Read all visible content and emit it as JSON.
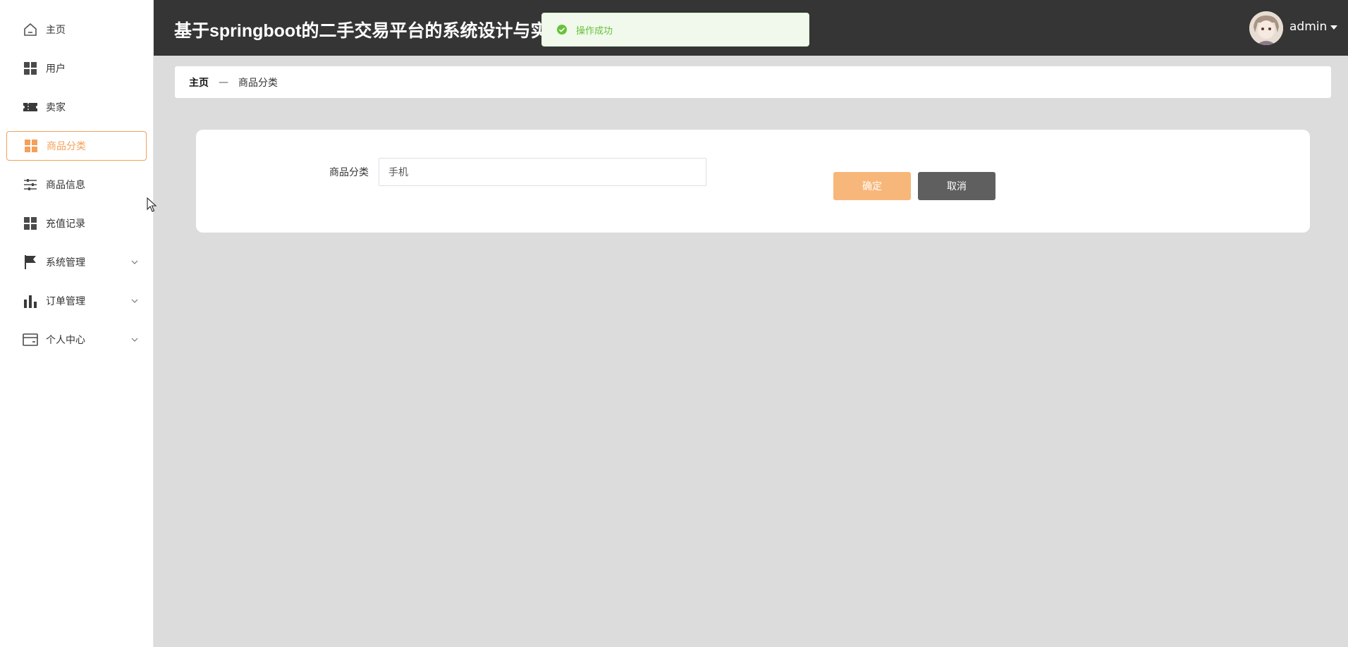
{
  "header": {
    "title": "基于springboot的二手交易平台的系统设计与实现",
    "user": "admin"
  },
  "toast": {
    "message": "操作成功",
    "color": "#67c23a"
  },
  "sidebar": {
    "items": [
      {
        "label": "主页",
        "icon": "home-icon"
      },
      {
        "label": "用户",
        "icon": "grid-icon"
      },
      {
        "label": "卖家",
        "icon": "ticket-icon"
      },
      {
        "label": "商品分类",
        "icon": "grid-icon",
        "active": true
      },
      {
        "label": "商品信息",
        "icon": "sliders-icon"
      },
      {
        "label": "充值记录",
        "icon": "grid-icon"
      },
      {
        "label": "系统管理",
        "icon": "flag-icon",
        "expandable": true
      },
      {
        "label": "订单管理",
        "icon": "bar-chart-icon",
        "expandable": true
      },
      {
        "label": "个人中心",
        "icon": "card-icon",
        "expandable": true
      }
    ],
    "active_color": "#f5a05a"
  },
  "breadcrumb": {
    "home": "主页",
    "separator": "—",
    "current": "商品分类"
  },
  "form": {
    "category_label": "商品分类",
    "category_value": "手机",
    "confirm_label": "确定",
    "cancel_label": "取消",
    "confirm_color": "#f8b77a",
    "cancel_color": "#5f5f5f"
  }
}
